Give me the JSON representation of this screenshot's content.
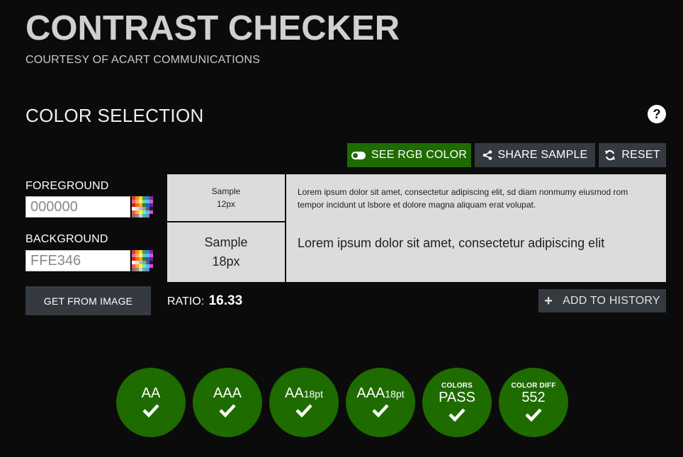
{
  "header": {
    "title": "CONTRAST CHECKER",
    "subtitle": "COURTESY OF ACART COMMUNICATIONS"
  },
  "section": {
    "title": "COLOR SELECTION",
    "help_icon": "question-circle-icon"
  },
  "toolbar": {
    "rgb_label": "SEE RGB COLOR",
    "share_label": "SHARE SAMPLE",
    "reset_label": "RESET"
  },
  "foreground": {
    "label": "FOREGROUND",
    "value": "000000"
  },
  "background": {
    "label": "BACKGROUND",
    "value": "FFE346"
  },
  "get_image_label": "GET FROM IMAGE",
  "sample": {
    "small_label_1": "Sample",
    "small_label_2": "12px",
    "large_label_1": "Sample",
    "large_label_2": "18px",
    "small_text": "Lorem ipsum dolor sit amet, consectetur adipiscing elit, sd diam nonmumy eiusmod rom tempor incidunt ut lsbore et dolore magna aliquam erat volupat.",
    "large_text": "Lorem ipsum dolor sit amet, consectetur adipiscing elit"
  },
  "ratio": {
    "label": "RATIO:",
    "value": "16.33"
  },
  "history_label": "ADD TO HISTORY",
  "results": [
    {
      "caption": "",
      "main": "AA",
      "suffix": "",
      "status": "pass"
    },
    {
      "caption": "",
      "main": "AAA",
      "suffix": "",
      "status": "pass"
    },
    {
      "caption": "",
      "main": "AA",
      "suffix": "18pt",
      "status": "pass"
    },
    {
      "caption": "",
      "main": "AAA",
      "suffix": "18pt",
      "status": "pass"
    },
    {
      "caption": "COLORS",
      "main": "PASS",
      "suffix": "",
      "status": "pass"
    },
    {
      "caption": "COLOR DIFF",
      "main": "552",
      "suffix": "",
      "status": "pass"
    }
  ],
  "colors": {
    "accent": "#1e6b00",
    "button_dark": "#353a40",
    "background": "#0b0b0b",
    "sample_bg": "#dcdcdc"
  }
}
